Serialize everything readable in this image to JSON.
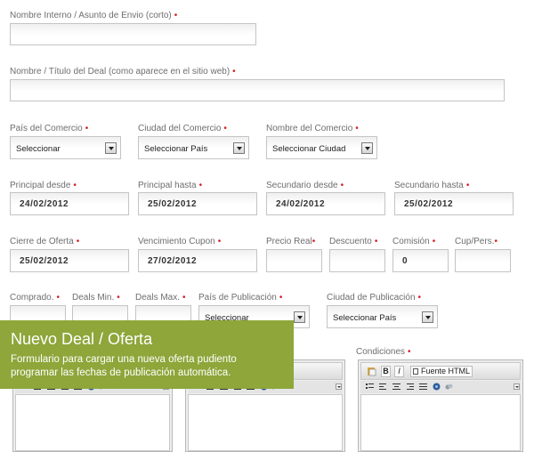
{
  "fields": {
    "nombre_interno": {
      "label": "Nombre Interno / Asunto de Envio (corto)",
      "value": ""
    },
    "nombre_titulo": {
      "label": "Nombre / Título del Deal (como aparece en el sitio web)",
      "value": ""
    },
    "pais_comercio": {
      "label": "País del Comercio",
      "value": "Seleccionar"
    },
    "ciudad_comercio": {
      "label": "Ciudad del Comercio",
      "value": "Seleccionar País"
    },
    "nombre_comercio": {
      "label": "Nombre del Comercio",
      "value": "Seleccionar Ciudad"
    },
    "principal_desde": {
      "label": "Principal desde",
      "value": "24/02/2012"
    },
    "principal_hasta": {
      "label": "Principal hasta",
      "value": "25/02/2012"
    },
    "secundario_desde": {
      "label": "Secundario desde",
      "value": "24/02/2012"
    },
    "secundario_hasta": {
      "label": "Secundario hasta",
      "value": "25/02/2012"
    },
    "cierre_oferta": {
      "label": "Cierre de Oferta",
      "value": "25/02/2012"
    },
    "vencimiento_cupon": {
      "label": "Vencimiento Cupon",
      "value": "27/02/2012"
    },
    "precio_real": {
      "label": "Precio Real",
      "value": ""
    },
    "descuento": {
      "label": "Descuento",
      "value": ""
    },
    "comision": {
      "label": "Comisión",
      "value": "0"
    },
    "cup_pers": {
      "label": "Cup/Pers.",
      "value": ""
    },
    "comprado": {
      "label": "Comprado.",
      "value": ""
    },
    "deals_min": {
      "label": "Deals Min.",
      "value": ""
    },
    "deals_max": {
      "label": "Deals Max.",
      "value": ""
    },
    "pais_publicacion": {
      "label": "País de Publicación",
      "value": "Seleccionar"
    },
    "ciudad_publicacion": {
      "label": "Ciudad de Publicación",
      "value": "Seleccionar País"
    },
    "condiciones": {
      "label": "Condiciones"
    }
  },
  "required_mark": "•",
  "editor": {
    "fuente_html": "Fuente HTML",
    "bold": "B",
    "italic": "I"
  },
  "banner": {
    "title": "Nuevo Deal / Oferta",
    "description": "Formulario para cargar una nueva oferta pudiento programar las fechas de publicación automática."
  },
  "colors": {
    "banner": "#8ea63a",
    "required": "#d21f1f"
  }
}
